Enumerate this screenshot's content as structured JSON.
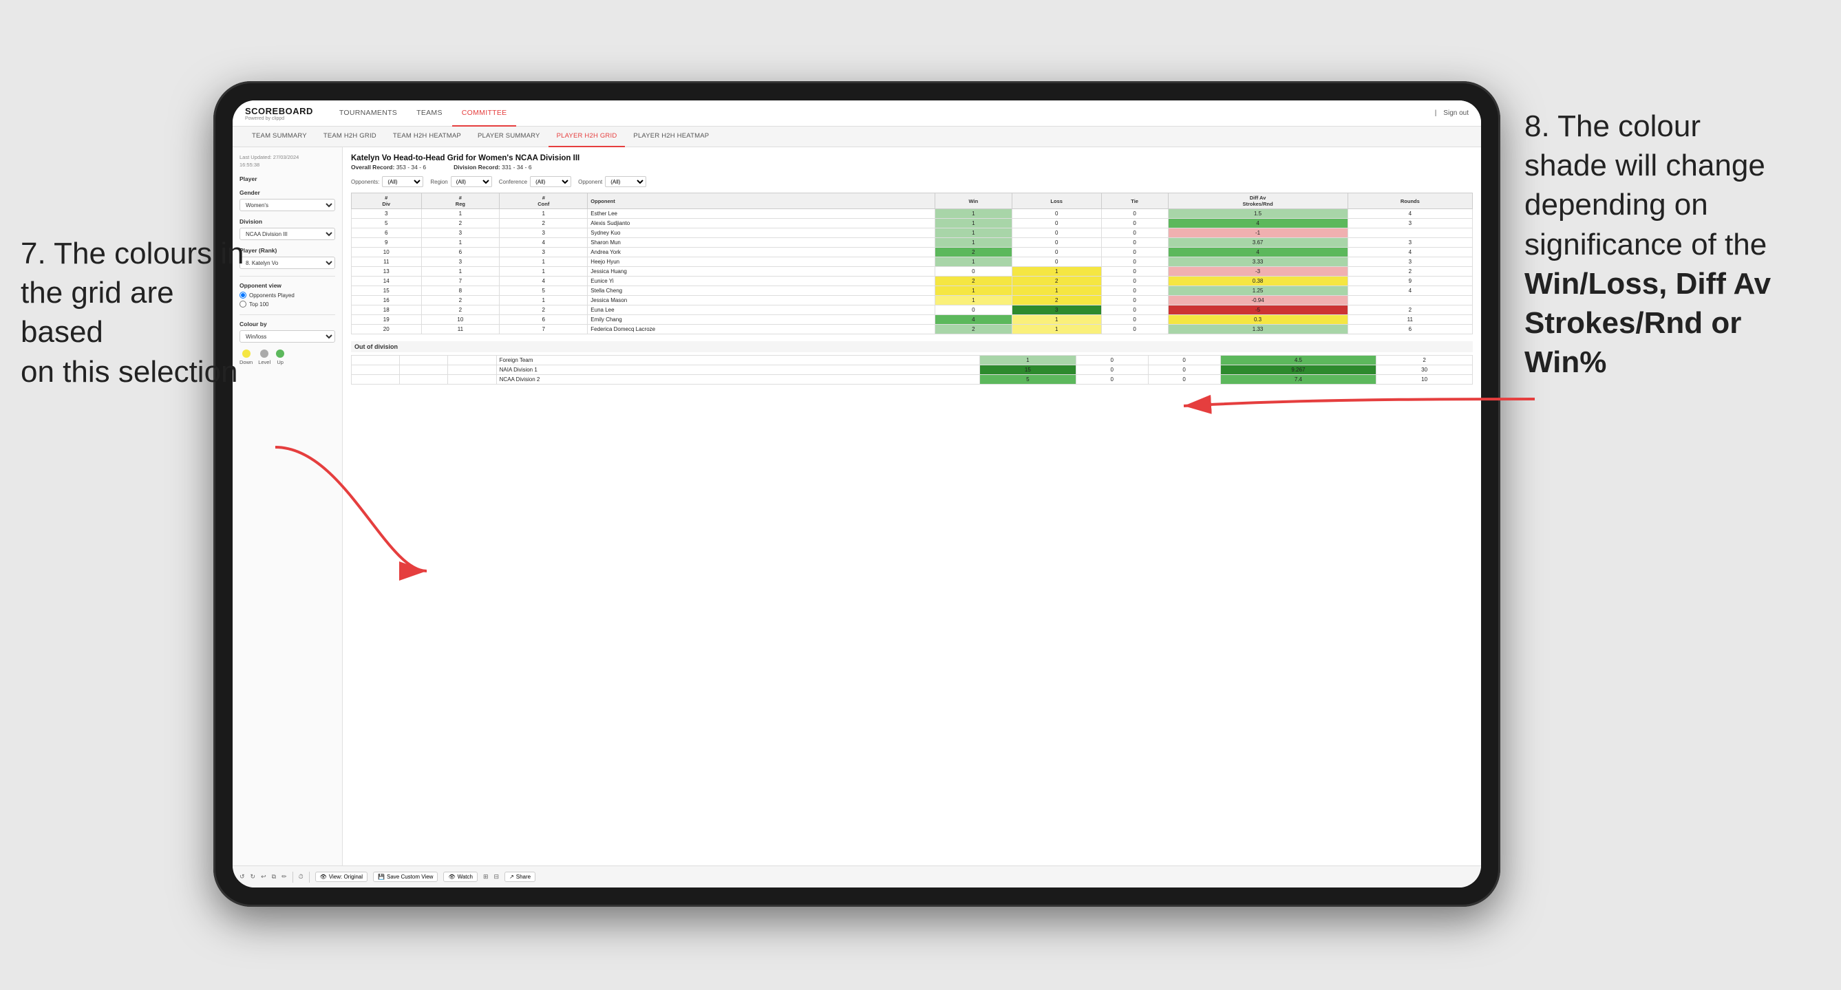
{
  "annotations": {
    "left": {
      "line1": "7. The colours in",
      "line2": "the grid are based",
      "line3": "on this selection"
    },
    "right": {
      "line1": "8. The colour",
      "line2": "shade will change",
      "line3": "depending on",
      "line4": "significance of the",
      "bold1": "Win/Loss",
      "comma1": ", ",
      "bold2": "Diff Av",
      "line5": "Strokes/Rnd",
      "or_text": " or",
      "bold3": "Win%"
    }
  },
  "header": {
    "logo": "SCOREBOARD",
    "logo_sub": "Powered by clippd",
    "nav": [
      "TOURNAMENTS",
      "TEAMS",
      "COMMITTEE"
    ],
    "active_nav": "COMMITTEE",
    "sign_in_label": "Sign out"
  },
  "sub_nav": {
    "items": [
      "TEAM SUMMARY",
      "TEAM H2H GRID",
      "TEAM H2H HEATMAP",
      "PLAYER SUMMARY",
      "PLAYER H2H GRID",
      "PLAYER H2H HEATMAP"
    ],
    "active": "PLAYER H2H GRID"
  },
  "sidebar": {
    "timestamp_label": "Last Updated: 27/03/2024",
    "timestamp_time": "16:55:38",
    "player_section": "Player",
    "gender_label": "Gender",
    "gender_value": "Women's",
    "division_label": "Division",
    "division_value": "NCAA Division III",
    "player_rank_label": "Player (Rank)",
    "player_rank_value": "8. Katelyn Vo",
    "opponent_view_label": "Opponent view",
    "opponent_played": "Opponents Played",
    "opponent_top100": "Top 100",
    "colour_by_label": "Colour by",
    "colour_by_value": "Win/loss",
    "legend": {
      "down_label": "Down",
      "level_label": "Level",
      "up_label": "Up"
    }
  },
  "grid": {
    "title": "Katelyn Vo Head-to-Head Grid for Women's NCAA Division III",
    "overall_record_label": "Overall Record:",
    "overall_record": "353 - 34 - 6",
    "division_record_label": "Division Record:",
    "division_record": "331 - 34 - 6",
    "filters": {
      "opponents_label": "Opponents:",
      "opponents_value": "(All)",
      "region_label": "Region",
      "region_value": "(All)",
      "conference_label": "Conference",
      "conference_value": "(All)",
      "opponent_label": "Opponent",
      "opponent_value": "(All)"
    },
    "columns": {
      "div": "#\nDiv",
      "reg": "#\nReg",
      "conf": "#\nConf",
      "opponent": "Opponent",
      "win": "Win",
      "loss": "Loss",
      "tie": "Tie",
      "diff_av": "Diff Av\nStrokes/Rnd",
      "rounds": "Rounds"
    },
    "rows": [
      {
        "div": 3,
        "reg": 1,
        "conf": 1,
        "opponent": "Esther Lee",
        "win": 1,
        "loss": 0,
        "tie": 0,
        "diff": 1.5,
        "rounds": 4,
        "win_cell": "green-light",
        "loss_cell": "white",
        "tie_cell": "white",
        "diff_cell": "green-light"
      },
      {
        "div": 5,
        "reg": 2,
        "conf": 2,
        "opponent": "Alexis Sudjianto",
        "win": 1,
        "loss": 0,
        "tie": 0,
        "diff": 4.0,
        "rounds": 3,
        "win_cell": "green-light",
        "loss_cell": "white",
        "tie_cell": "white",
        "diff_cell": "green-med"
      },
      {
        "div": 6,
        "reg": 3,
        "conf": 3,
        "opponent": "Sydney Kuo",
        "win": 1,
        "loss": 0,
        "tie": 0,
        "diff": -1.0,
        "rounds": "",
        "win_cell": "green-light",
        "loss_cell": "white",
        "tie_cell": "white",
        "diff_cell": "red-light"
      },
      {
        "div": 9,
        "reg": 1,
        "conf": 4,
        "opponent": "Sharon Mun",
        "win": 1,
        "loss": 0,
        "tie": 0,
        "diff": 3.67,
        "rounds": 3,
        "win_cell": "green-light",
        "loss_cell": "white",
        "tie_cell": "white",
        "diff_cell": "green-light"
      },
      {
        "div": 10,
        "reg": 6,
        "conf": 3,
        "opponent": "Andrea York",
        "win": 2,
        "loss": 0,
        "tie": 0,
        "diff": 4.0,
        "rounds": 4,
        "win_cell": "green-med",
        "loss_cell": "white",
        "tie_cell": "white",
        "diff_cell": "green-med"
      },
      {
        "div": 11,
        "reg": 3,
        "conf": 1,
        "opponent": "Heejo Hyun",
        "win": 1,
        "loss": 0,
        "tie": 0,
        "diff": 3.33,
        "rounds": 3,
        "win_cell": "green-light",
        "loss_cell": "white",
        "tie_cell": "white",
        "diff_cell": "green-light"
      },
      {
        "div": 13,
        "reg": 1,
        "conf": 1,
        "opponent": "Jessica Huang",
        "win": 0,
        "loss": 1,
        "tie": 0,
        "diff": -3.0,
        "rounds": 2,
        "win_cell": "white",
        "loss_cell": "yellow",
        "tie_cell": "white",
        "diff_cell": "red-light"
      },
      {
        "div": 14,
        "reg": 7,
        "conf": 4,
        "opponent": "Eunice Yi",
        "win": 2,
        "loss": 2,
        "tie": 0,
        "diff": 0.38,
        "rounds": 9,
        "win_cell": "yellow",
        "loss_cell": "yellow",
        "tie_cell": "white",
        "diff_cell": "yellow"
      },
      {
        "div": 15,
        "reg": 8,
        "conf": 5,
        "opponent": "Stella Cheng",
        "win": 1,
        "loss": 1,
        "tie": 0,
        "diff": 1.25,
        "rounds": 4,
        "win_cell": "yellow",
        "loss_cell": "yellow",
        "tie_cell": "white",
        "diff_cell": "green-light"
      },
      {
        "div": 16,
        "reg": 2,
        "conf": 1,
        "opponent": "Jessica Mason",
        "win": 1,
        "loss": 2,
        "tie": 0,
        "diff": -0.94,
        "rounds": "",
        "win_cell": "yellow-light",
        "loss_cell": "yellow",
        "tie_cell": "white",
        "diff_cell": "red-light"
      },
      {
        "div": 18,
        "reg": 2,
        "conf": 2,
        "opponent": "Euna Lee",
        "win": 0,
        "loss": 3,
        "tie": 0,
        "diff": -5.0,
        "rounds": 2,
        "win_cell": "white",
        "loss_cell": "green-dark",
        "tie_cell": "white",
        "diff_cell": "red-dark"
      },
      {
        "div": 19,
        "reg": 10,
        "conf": 6,
        "opponent": "Emily Chang",
        "win": 4,
        "loss": 1,
        "tie": 0,
        "diff": 0.3,
        "rounds": 11,
        "win_cell": "green-med",
        "loss_cell": "yellow-light",
        "tie_cell": "white",
        "diff_cell": "yellow"
      },
      {
        "div": 20,
        "reg": 11,
        "conf": 7,
        "opponent": "Federica Domecq Lacroze",
        "win": 2,
        "loss": 1,
        "tie": 0,
        "diff": 1.33,
        "rounds": 6,
        "win_cell": "green-light",
        "loss_cell": "yellow-light",
        "tie_cell": "white",
        "diff_cell": "green-light"
      }
    ],
    "out_of_division_label": "Out of division",
    "out_of_division_rows": [
      {
        "team": "Foreign Team",
        "win": 1,
        "loss": 0,
        "tie": 0,
        "diff": 4.5,
        "rounds": 2,
        "win_cell": "green-light",
        "loss_cell": "white",
        "tie_cell": "white",
        "diff_cell": "green-med"
      },
      {
        "team": "NAIA Division 1",
        "win": 15,
        "loss": 0,
        "tie": 0,
        "diff": 9.267,
        "rounds": 30,
        "win_cell": "green-dark",
        "loss_cell": "white",
        "tie_cell": "white",
        "diff_cell": "green-dark"
      },
      {
        "team": "NCAA Division 2",
        "win": 5,
        "loss": 0,
        "tie": 0,
        "diff": 7.4,
        "rounds": 10,
        "win_cell": "green-med",
        "loss_cell": "white",
        "tie_cell": "white",
        "diff_cell": "green-med"
      }
    ]
  },
  "toolbar": {
    "view_original": "View: Original",
    "save_custom": "Save Custom View",
    "watch": "Watch",
    "share": "Share"
  }
}
